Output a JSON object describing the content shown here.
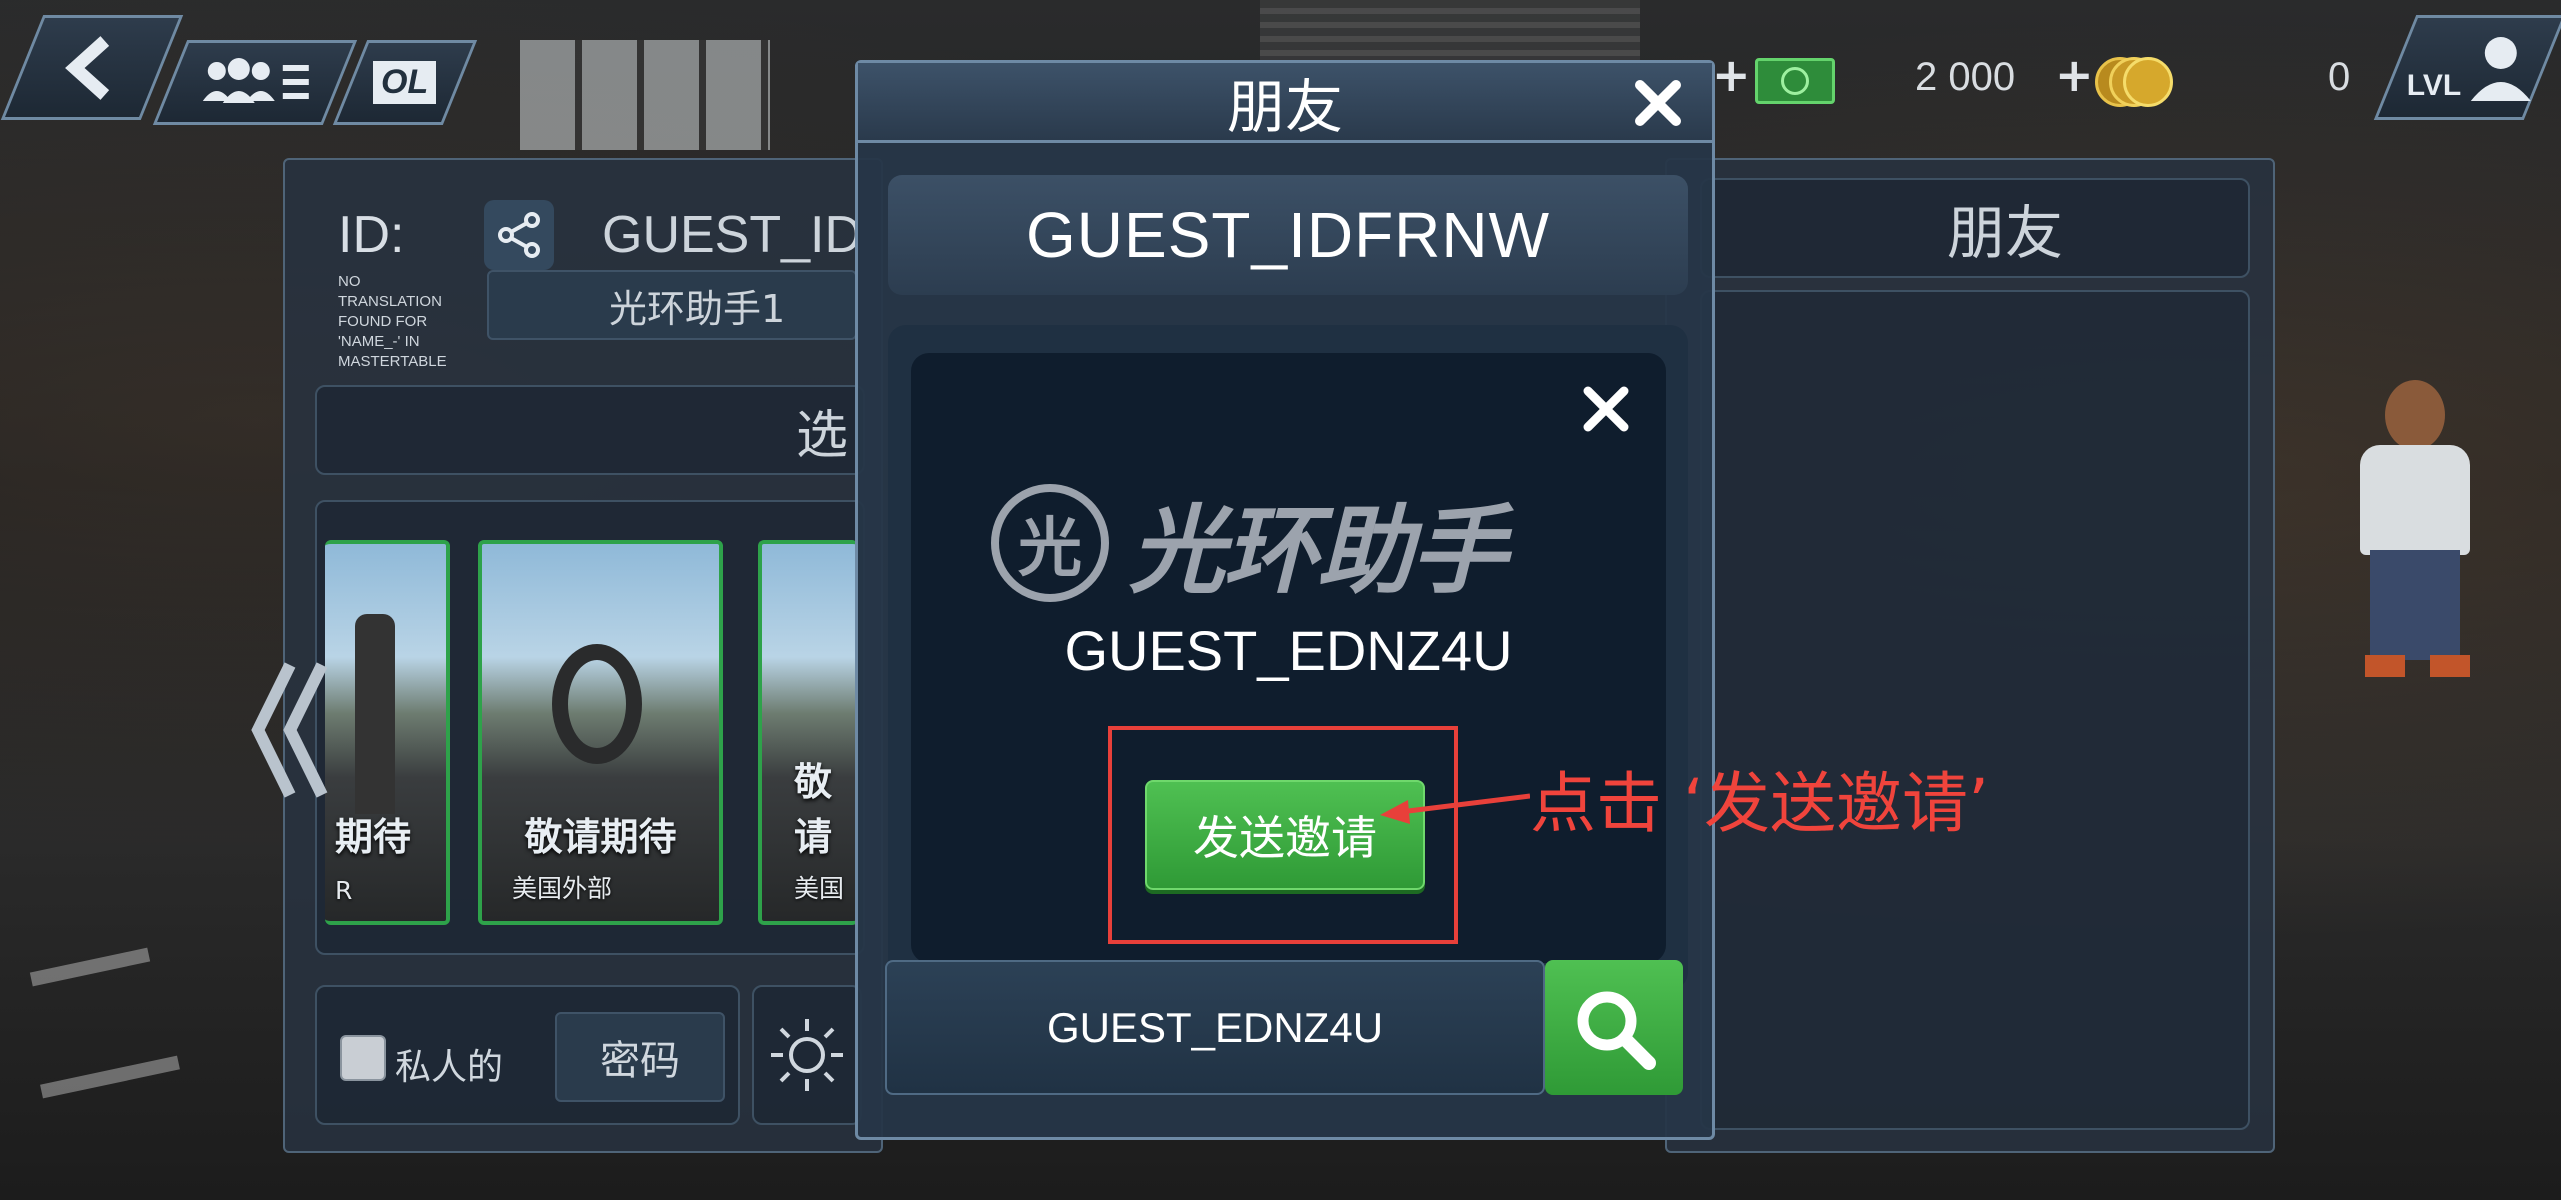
{
  "top_bar": {
    "money_value": "2 000",
    "gold_value": "0",
    "level_label": "LVL",
    "ol_label": "OL"
  },
  "left_panel": {
    "id_label": "ID:",
    "id_value": "GUEST_IDFRNV",
    "translation_note": "NO TRANSLATION FOUND FOR 'NAME_-' IN MASTERTABLE",
    "player_name": "光环助手1",
    "section_header_partial": "选",
    "cards": [
      {
        "title": "期待",
        "subtitle": "R"
      },
      {
        "title": "敬请期待",
        "subtitle": "美国外部"
      },
      {
        "title": "敬请",
        "subtitle": "美国"
      }
    ],
    "private_label": "私人的",
    "password_label": "密码"
  },
  "right_panel": {
    "title": "朋友"
  },
  "modal": {
    "title": "朋友",
    "my_id": "GUEST_IDFRNW",
    "found_player": "GUEST_EDNZ4U",
    "watermark_text": "光环助手",
    "watermark_logo_char": "光",
    "send_invite_label": "发送邀请",
    "search_value": "GUEST_EDNZ4U"
  },
  "annotation": {
    "text": "点击 ‘发送邀请’"
  },
  "colors": {
    "accent_green": "#3aa843",
    "annotation_red": "#e8403a",
    "panel_blue": "#283240"
  }
}
